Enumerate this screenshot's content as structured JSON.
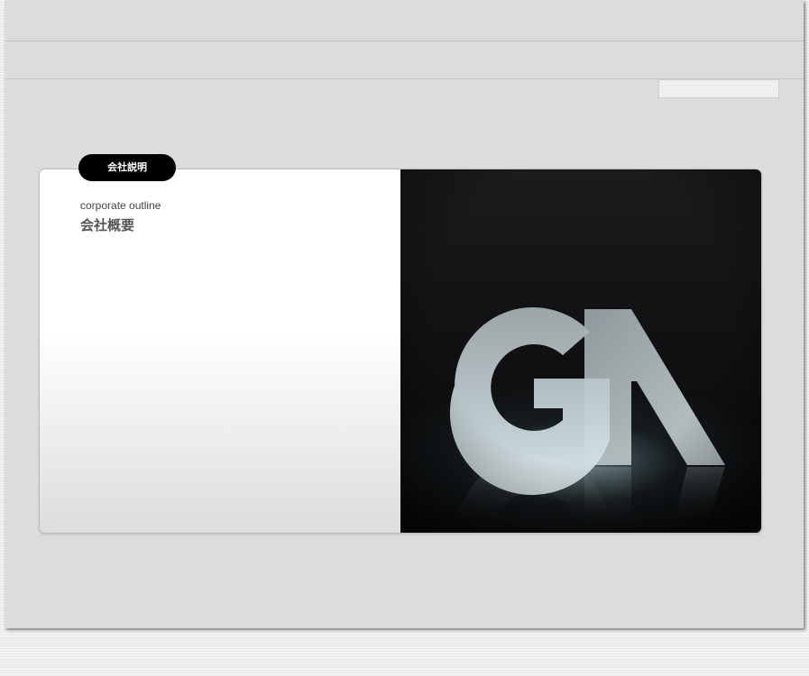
{
  "section_tab": {
    "label": "会社説明"
  },
  "content": {
    "subtitle": "corporate outline",
    "title": "会社概要"
  },
  "hero_image": {
    "logo_text": "GA"
  },
  "colors": {
    "page_bg": "#dcdcdc",
    "tab_bg": "#000000",
    "tab_text": "#ffffff"
  }
}
